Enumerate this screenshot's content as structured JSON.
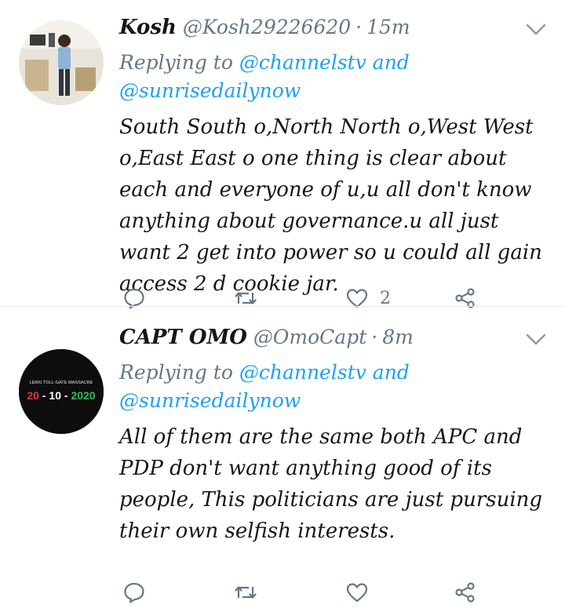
{
  "tweets": [
    {
      "name": "Kosh",
      "handle": "@Kosh29226620",
      "time": "15m",
      "replying_prefix": "Replying to",
      "mention1": "@channelstv",
      "and": "and",
      "mention2": "@sunrisedailynow",
      "text": "South South o,North North o,West West o,East East o one thing is clear about each and everyone of u,u all don't know anything about governance.u all just want 2 get into power so u could all gain access 2 d cookie jar.",
      "like_count": "2"
    },
    {
      "name": "CAPT OMO",
      "handle": "@OmoCapt",
      "time": "8m",
      "replying_prefix": "Replying to",
      "mention1": "@channelstv",
      "and": "and",
      "mention2": "@sunrisedailynow",
      "text": "All of them are the same both APC and PDP don't want anything good of its people, This politicians are just pursuing their own selfish interests.",
      "like_count": "",
      "avatar_text_top": "LEKKI TOLL-GATE MASSACRE",
      "avatar_text_main": "20 - 10 - 2020"
    }
  ],
  "separator": "·",
  "colors": {
    "link": "#1da1f2",
    "muted": "#657786",
    "text": "#14171a"
  },
  "icons": [
    "reply-icon",
    "retweet-icon",
    "like-icon",
    "share-icon",
    "chevron-down-icon"
  ]
}
